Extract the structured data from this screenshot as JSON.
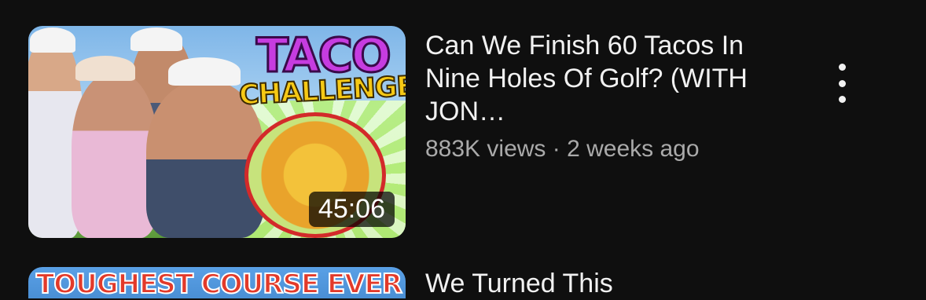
{
  "videos": [
    {
      "title": "Can We Finish 60 Tacos In Nine Holes Of Golf? (WITH JON…",
      "views": "883K views",
      "separator": "·",
      "age": "2 weeks ago",
      "duration": "45:06",
      "thumbnail_text_line1": "TACO",
      "thumbnail_text_line2": "CHALLENGE"
    },
    {
      "title": "We Turned This",
      "thumbnail_text": "TOUGHEST COURSE EVER"
    }
  ],
  "menu_icon": "more-vertical-icon"
}
